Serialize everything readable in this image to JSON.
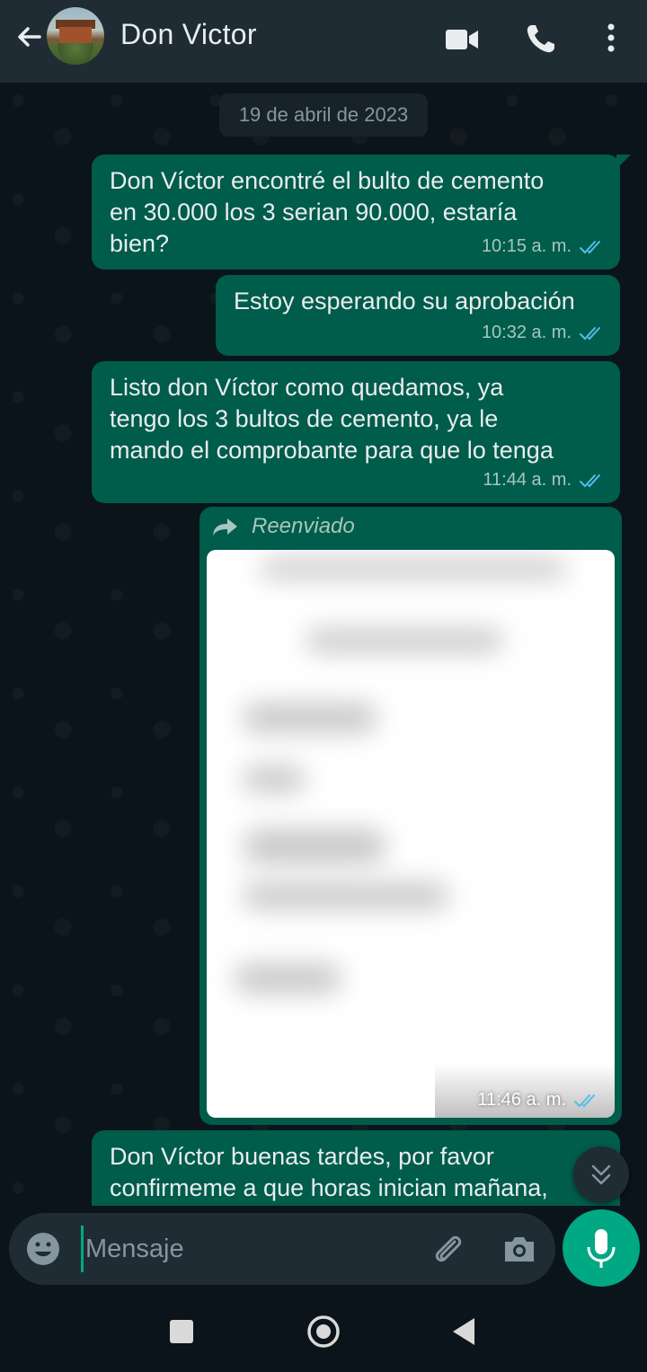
{
  "header": {
    "contact_name": "Don Victor"
  },
  "chat": {
    "date_chip": "19 de abril de 2023",
    "messages": [
      {
        "lines": [
          "Don Víctor encontré el bulto de cemento",
          "en 30.000 los 3 serian 90.000, estaría",
          "bien?"
        ],
        "time": "10:15 a. m.",
        "status": "read"
      },
      {
        "lines": [
          "Estoy esperando su aprobación"
        ],
        "time": "10:32 a. m.",
        "status": "read"
      },
      {
        "lines": [
          "Listo don Víctor como quedamos, ya",
          "tengo los 3 bultos de cemento, ya le",
          "mando el comprobante para que lo tenga"
        ],
        "time": "11:44 a. m.",
        "status": "read"
      },
      {
        "forwarded_label": "Reenviado",
        "type": "image",
        "time": "11:46 a. m.",
        "status": "read"
      },
      {
        "lines": [
          "Don Víctor buenas tardes, por favor",
          "confirmeme a que horas inician mañana,"
        ]
      }
    ]
  },
  "composer": {
    "placeholder": "Mensaje"
  },
  "colors": {
    "header_bg": "#1f2c34",
    "chat_bg": "#0b141a",
    "outgoing_bubble": "#005c4b",
    "accent": "#00a884",
    "read_ticks": "#53bdeb"
  },
  "icons": {
    "back": "arrow-left-icon",
    "video": "video-camera-icon",
    "call": "phone-icon",
    "menu": "more-vertical-icon",
    "emoji": "emoji-icon",
    "attach": "paperclip-icon",
    "camera": "camera-icon",
    "mic": "microphone-icon",
    "forward": "forward-arrow-icon",
    "scroll_down": "chevron-double-down-icon"
  }
}
